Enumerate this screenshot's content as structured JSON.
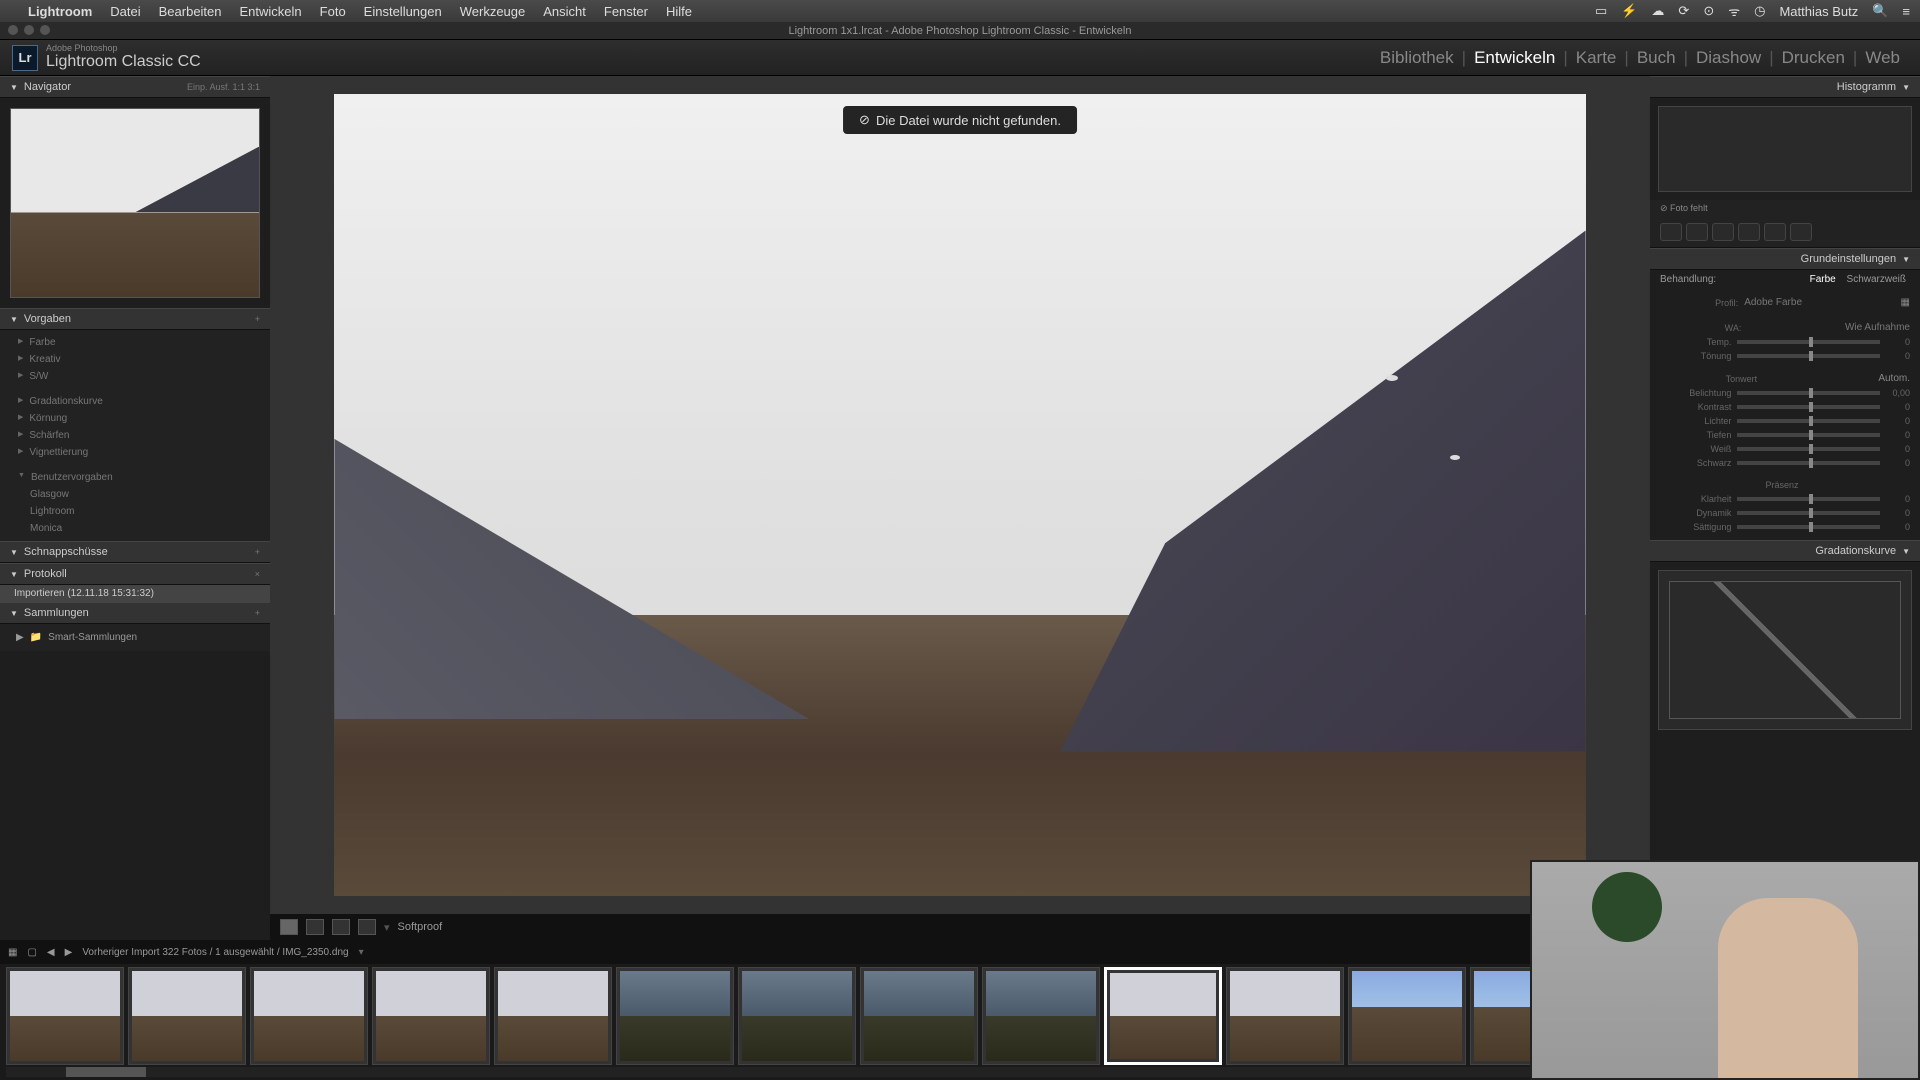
{
  "menubar": {
    "app": "Lightroom",
    "items": [
      "Datei",
      "Bearbeiten",
      "Entwickeln",
      "Foto",
      "Einstellungen",
      "Werkzeuge",
      "Ansicht",
      "Fenster",
      "Hilfe"
    ],
    "user": "Matthias Butz"
  },
  "window": {
    "title": "Lightroom 1x1.lrcat - Adobe Photoshop Lightroom Classic - Entwickeln"
  },
  "branding": {
    "icon": "Lr",
    "small": "Adobe Photoshop",
    "name": "Lightroom Classic CC"
  },
  "modules": [
    "Bibliothek",
    "Entwickeln",
    "Karte",
    "Buch",
    "Diashow",
    "Drucken",
    "Web"
  ],
  "active_module": "Entwickeln",
  "left": {
    "navigator": {
      "title": "Navigator",
      "modes": "Einp.   Ausf.   1:1   3:1"
    },
    "presets": {
      "title": "Vorgaben",
      "items": [
        "Farbe",
        "Kreativ",
        "S/W"
      ],
      "group2": [
        "Gradationskurve",
        "Körnung",
        "Schärfen",
        "Vignettierung"
      ],
      "group3_title": "Benutzervorgaben",
      "group3": [
        "Glasgow",
        "Lightroom",
        "Monica"
      ]
    },
    "snapshots": {
      "title": "Schnappschüsse"
    },
    "history": {
      "title": "Protokoll",
      "entry": "Importieren (12.11.18 15:31:32)"
    },
    "collections": {
      "title": "Sammlungen",
      "entry": "Smart-Sammlungen"
    }
  },
  "center": {
    "error": "Die Datei wurde nicht gefunden.",
    "toolbar": {
      "softproof": "Softproof"
    }
  },
  "right": {
    "histogram": {
      "title": "Histogramm"
    },
    "status": "Foto fehlt",
    "basic": {
      "title": "Grundeinstellungen",
      "treatment": "Behandlung:",
      "color": "Farbe",
      "bw": "Schwarzweiß",
      "profile": "Profil:",
      "profile_val": "Adobe Farbe",
      "wb": "WA:",
      "wb_val": "Wie Aufnahme",
      "sliders1": [
        {
          "l": "Temp.",
          "v": "0"
        },
        {
          "l": "Tönung",
          "v": "0"
        }
      ],
      "tone_title": "Tonwert",
      "auto": "Autom.",
      "sliders2": [
        {
          "l": "Belichtung",
          "v": "0,00"
        },
        {
          "l": "Kontrast",
          "v": "0"
        },
        {
          "l": "Lichter",
          "v": "0"
        },
        {
          "l": "Tiefen",
          "v": "0"
        },
        {
          "l": "Weiß",
          "v": "0"
        },
        {
          "l": "Schwarz",
          "v": "0"
        }
      ],
      "presence_title": "Präsenz",
      "sliders3": [
        {
          "l": "Klarheit",
          "v": "0"
        },
        {
          "l": "Dynamik",
          "v": "0"
        },
        {
          "l": "Sättigung",
          "v": "0"
        }
      ]
    },
    "curve": {
      "title": "Gradationskurve"
    }
  },
  "filmstrip": {
    "breadcrumb": "Vorheriger Import   322 Fotos / 1 ausgewählt / IMG_2350.dng"
  }
}
